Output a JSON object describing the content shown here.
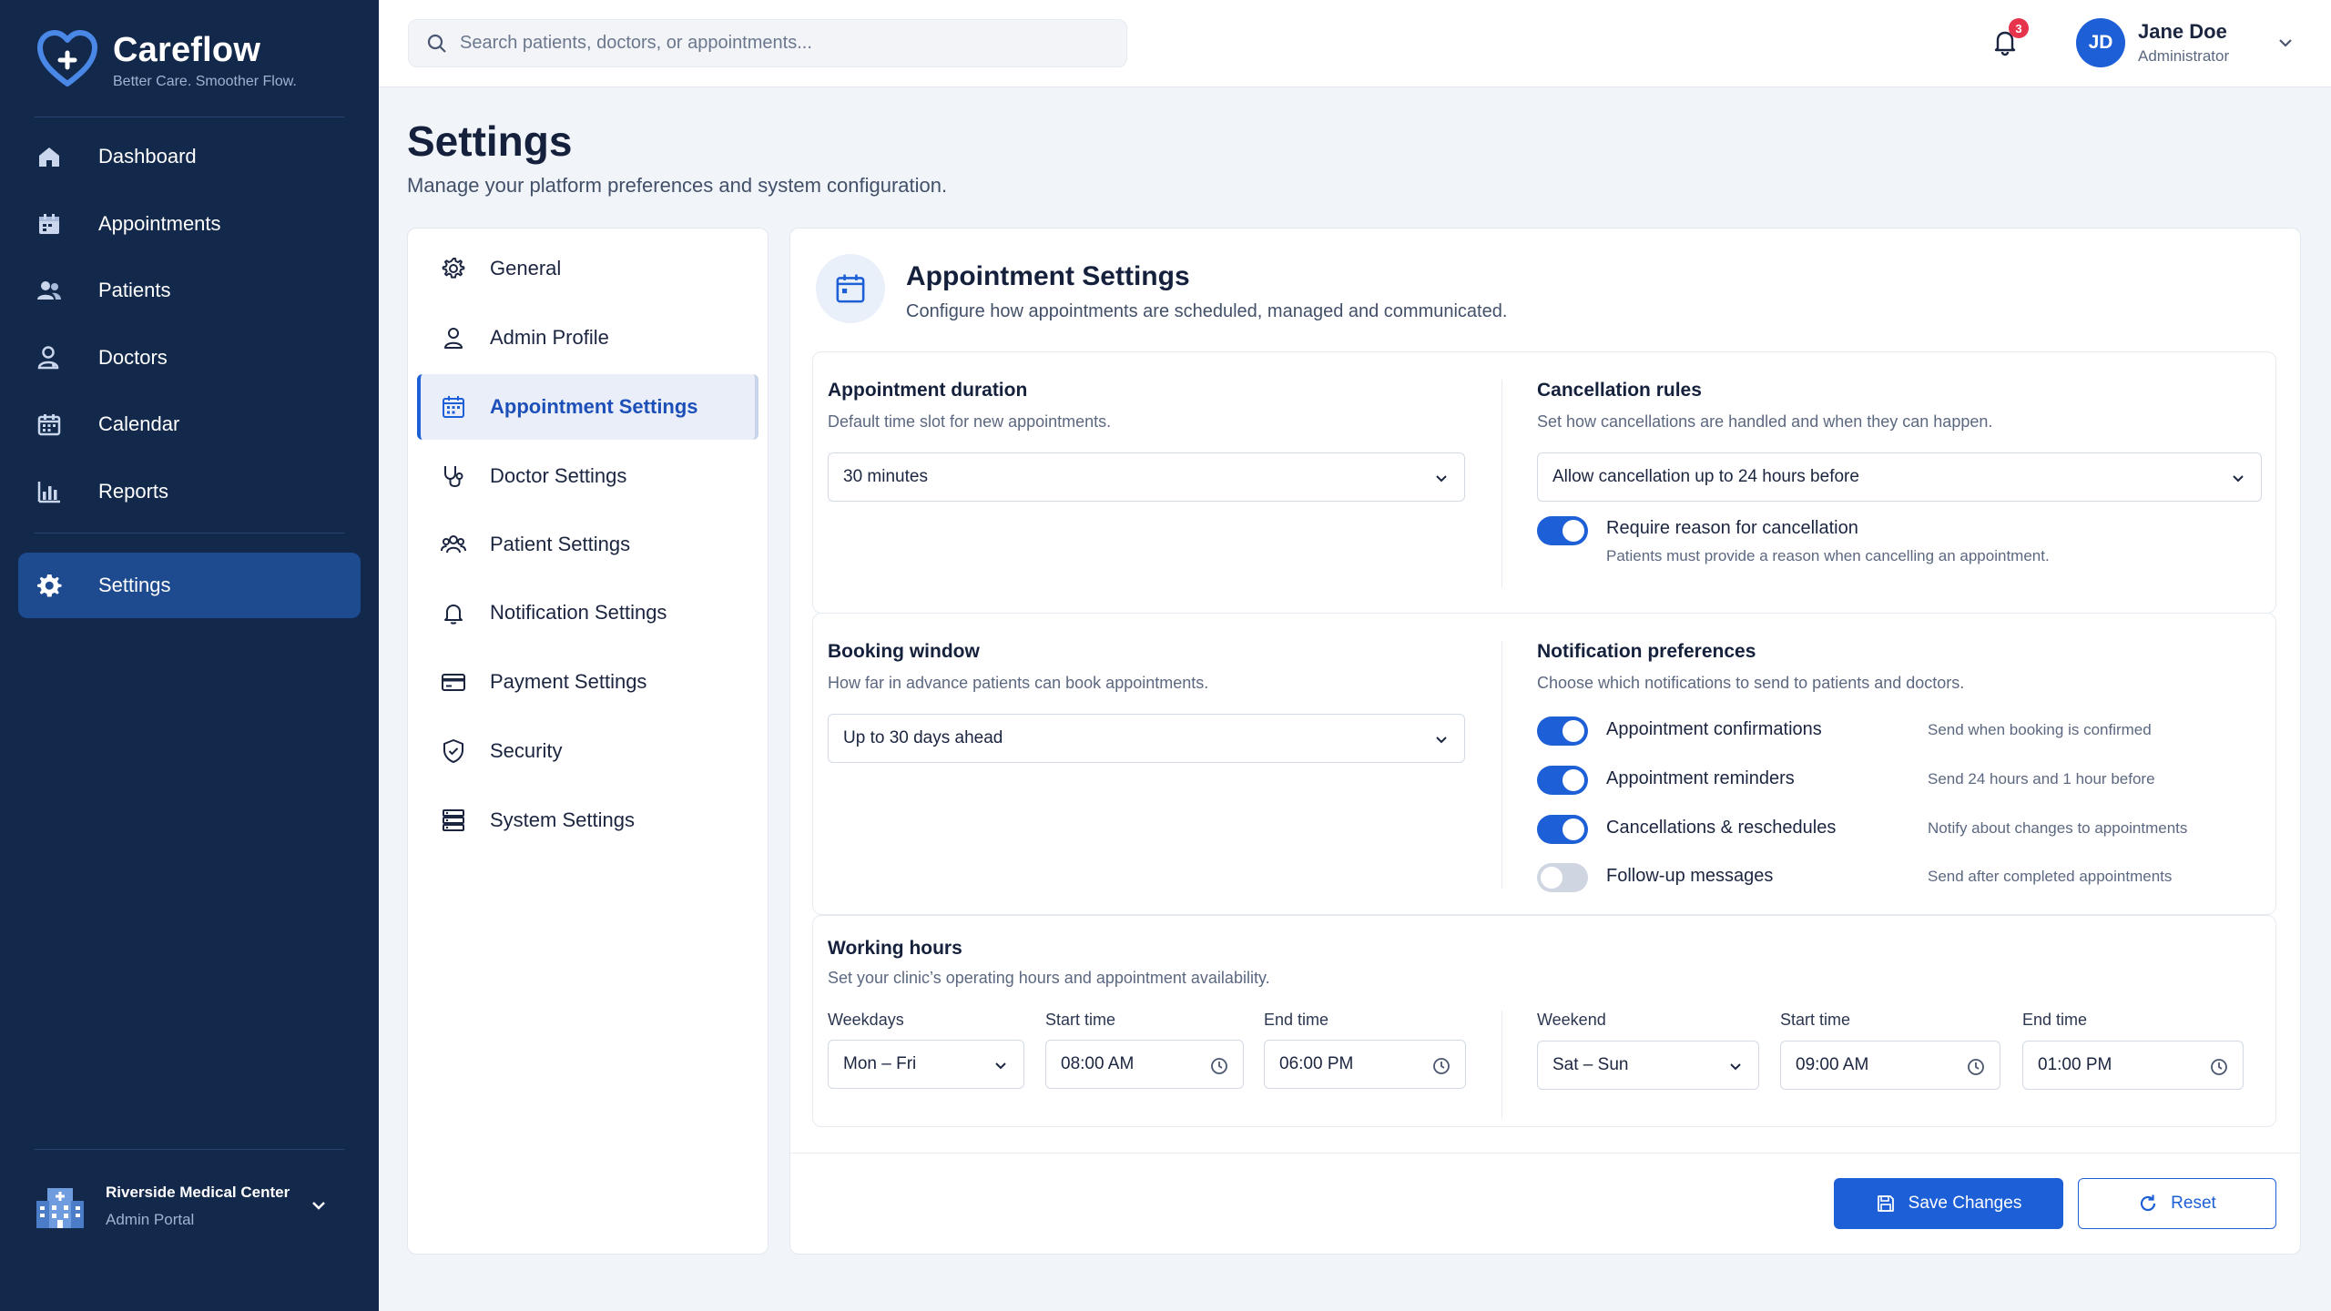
{
  "brand": {
    "name": "Careflow",
    "tagline": "Better Care. Smoother Flow."
  },
  "sidebar": {
    "items": [
      {
        "label": "Dashboard",
        "icon": "home-icon"
      },
      {
        "label": "Appointments",
        "icon": "calendar-icon"
      },
      {
        "label": "Patients",
        "icon": "users-icon"
      },
      {
        "label": "Doctors",
        "icon": "doctor-icon"
      },
      {
        "label": "Calendar",
        "icon": "calendar-grid-icon"
      },
      {
        "label": "Reports",
        "icon": "bar-chart-icon"
      },
      {
        "label": "Settings",
        "icon": "gear-icon",
        "active": true
      }
    ],
    "org": {
      "name": "Riverside Medical Center",
      "sub": "Admin Portal"
    }
  },
  "topbar": {
    "search_placeholder": "Search patients, doctors, or appointments...",
    "notifications_count": "3",
    "user": {
      "initials": "JD",
      "name": "Jane Doe",
      "role": "Administrator"
    }
  },
  "page": {
    "title": "Settings",
    "subtitle": "Manage your platform preferences and system configuration."
  },
  "settings_menu": [
    {
      "label": "General",
      "icon": "gear-icon"
    },
    {
      "label": "Admin Profile",
      "icon": "user-icon"
    },
    {
      "label": "Appointment Settings",
      "icon": "calendar-icon",
      "active": true
    },
    {
      "label": "Doctor Settings",
      "icon": "stethoscope-icon"
    },
    {
      "label": "Patient Settings",
      "icon": "users-icon"
    },
    {
      "label": "Notification Settings",
      "icon": "bell-icon"
    },
    {
      "label": "Payment Settings",
      "icon": "credit-card-icon"
    },
    {
      "label": "Security",
      "icon": "shield-icon"
    },
    {
      "label": "System Settings",
      "icon": "server-icon"
    }
  ],
  "panel": {
    "title": "Appointment Settings",
    "subtitle": "Configure how appointments are scheduled, managed and communicated.",
    "duration": {
      "title": "Appointment duration",
      "sub": "Default time slot for new appointments.",
      "value": "30 minutes"
    },
    "cancellation": {
      "title": "Cancellation rules",
      "sub": "Set how cancellations are handled and when they can happen.",
      "value": "Allow cancellation up to 24 hours before",
      "toggle_label": "Require reason for cancellation",
      "toggle_desc": "Patients must provide a reason when cancelling an appointment.",
      "toggle_on": true
    },
    "booking": {
      "title": "Booking window",
      "sub": "How far in advance patients can book appointments.",
      "value": "Up to 30 days ahead"
    },
    "notifications": {
      "title": "Notification preferences",
      "sub": "Choose which notifications to send to patients and doctors.",
      "items": [
        {
          "label": "Appointment confirmations",
          "desc": "Send when booking is confirmed",
          "on": true
        },
        {
          "label": "Appointment reminders",
          "desc": "Send 24 hours and 1 hour before",
          "on": true
        },
        {
          "label": "Cancellations & reschedules",
          "desc": "Notify about changes to appointments",
          "on": true
        },
        {
          "label": "Follow-up messages",
          "desc": "Send after completed appointments",
          "on": false
        }
      ]
    },
    "working_hours": {
      "title": "Working hours",
      "sub": "Set your clinic’s operating hours and appointment availability.",
      "weekdays": {
        "label": "Weekdays",
        "value": "Mon – Fri",
        "start_label": "Start time",
        "start": "08:00 AM",
        "end_label": "End time",
        "end": "06:00 PM"
      },
      "weekend": {
        "label": "Weekend",
        "value": "Sat – Sun",
        "start_label": "Start time",
        "start": "09:00 AM",
        "end_label": "End time",
        "end": "01:00 PM"
      }
    },
    "buttons": {
      "save": "Save Changes",
      "reset": "Reset"
    }
  },
  "colors": {
    "sidebar": "#13294b",
    "accent": "#1d5fd6",
    "active_nav": "#1e4a8f",
    "badge": "#e5344b"
  }
}
